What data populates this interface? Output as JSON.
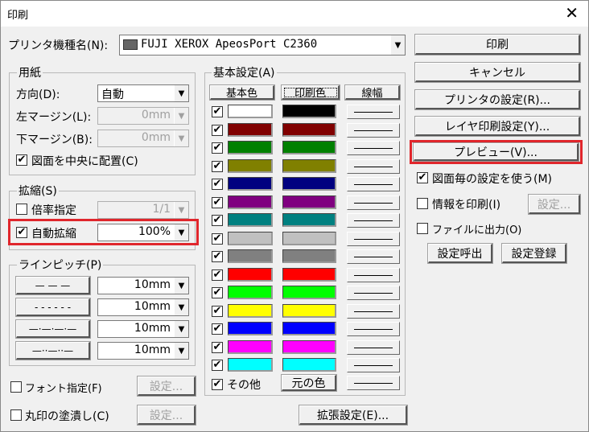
{
  "window": {
    "title": "印刷",
    "close_glyph": "✕"
  },
  "printer": {
    "label": "プリンタ機種名(N):",
    "value": "FUJI XEROX ApeosPort C2360"
  },
  "paper": {
    "group_label": "用紙",
    "orientation_label": "方向(D):",
    "orientation_value": "自動",
    "left_margin_label": "左マージン(L):",
    "left_margin_value": "0mm",
    "bottom_margin_label": "下マージン(B):",
    "bottom_margin_value": "0mm",
    "center_label": "図面を中央に配置(C)"
  },
  "scale": {
    "group_label": "拡縮(S)",
    "ratio_label": "倍率指定",
    "ratio_value": "1/1",
    "auto_label": "自動拡縮",
    "auto_value": "100%"
  },
  "line_pitch": {
    "group_label": "ラインピッチ(P)",
    "patterns": [
      "— — —",
      "- - - - - -",
      "—·—·—·—",
      "—··—··—"
    ],
    "values": [
      "10mm",
      "10mm",
      "10mm",
      "10mm"
    ]
  },
  "font_spec": {
    "label": "フォント指定(F)",
    "settings": "設定..."
  },
  "fill_circle": {
    "label": "丸印の塗潰し(C)",
    "settings": "設定..."
  },
  "basic": {
    "group_label": "基本設定(A)",
    "col_base": "基本色",
    "col_print": "印刷色",
    "col_width": "線幅",
    "colors": [
      "#ffffff",
      "#800000",
      "#008000",
      "#808000",
      "#000080",
      "#800080",
      "#008080",
      "#c0c0c0",
      "#808080",
      "#ff0000",
      "#00ff00",
      "#ffff00",
      "#0000ff",
      "#ff00ff",
      "#00ffff"
    ],
    "print_colors": [
      "#000000",
      "#800000",
      "#008000",
      "#808000",
      "#000080",
      "#800080",
      "#008080",
      "#c0c0c0",
      "#808080",
      "#ff0000",
      "#00ff00",
      "#ffff00",
      "#0000ff",
      "#ff00ff",
      "#00ffff"
    ],
    "other_label": "その他",
    "original_color": "元の色",
    "check_glyph": "✔"
  },
  "extended_button": "拡張設定(E)...",
  "right": {
    "print": "印刷",
    "cancel": "キャンセル",
    "printer_settings": "プリンタの設定(R)...",
    "layer_print": "レイヤ印刷設定(Y)...",
    "preview": "プレビュー(V)...",
    "per_drawing_label": "図面毎の設定を使う(M)",
    "info_print_label": "情報を印刷(I)",
    "info_settings": "設定...",
    "file_output_label": "ファイルに出力(O)",
    "recall": "設定呼出",
    "register": "設定登録"
  },
  "accent": "#e0262c"
}
